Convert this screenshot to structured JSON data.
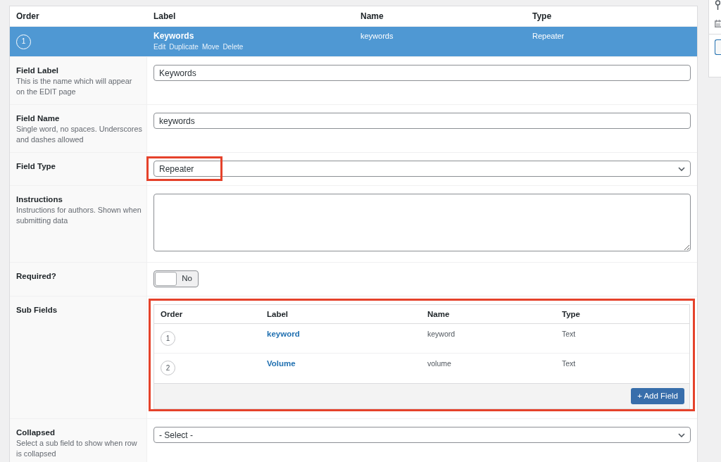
{
  "main_table": {
    "columns": [
      "Order",
      "Label",
      "Name",
      "Type"
    ],
    "rows": [
      {
        "order": "1",
        "label": "Keywords",
        "actions": [
          "Edit",
          "Duplicate",
          "Move",
          "Delete"
        ],
        "name": "keywords",
        "type": "Repeater",
        "selected": true
      }
    ]
  },
  "settings": [
    {
      "kind": "text",
      "label": "Field Label",
      "description": "This is the name which will appear on the EDIT page",
      "value": "Keywords",
      "highlighted": false
    },
    {
      "kind": "text",
      "label": "Field Name",
      "description": "Single word, no spaces. Underscores and dashes allowed",
      "value": "keywords",
      "highlighted": false
    },
    {
      "kind": "select",
      "label": "Field Type",
      "value": "Repeater",
      "highlighted": true
    },
    {
      "kind": "textarea",
      "label": "Instructions",
      "description": "Instructions for authors. Shown when submitting data",
      "highlighted": false
    },
    {
      "kind": "toggle",
      "label": "Required?",
      "on": false,
      "state_label": "No",
      "highlighted": false
    },
    {
      "kind": "subfields",
      "label": "Sub Fields",
      "highlighted": true,
      "columns": [
        "Order",
        "Label",
        "Name",
        "Type"
      ],
      "rows": [
        {
          "order": "1",
          "label": "keyword",
          "name": "keyword",
          "type": "Text"
        },
        {
          "order": "2",
          "label": "Volume",
          "name": "volume",
          "type": "Text"
        }
      ],
      "add_button": "+ Add Field"
    },
    {
      "kind": "select",
      "label": "Collapsed",
      "description": "Select a sub field to show when row is collapsed",
      "value": "- Select -",
      "highlighted": false
    }
  ]
}
